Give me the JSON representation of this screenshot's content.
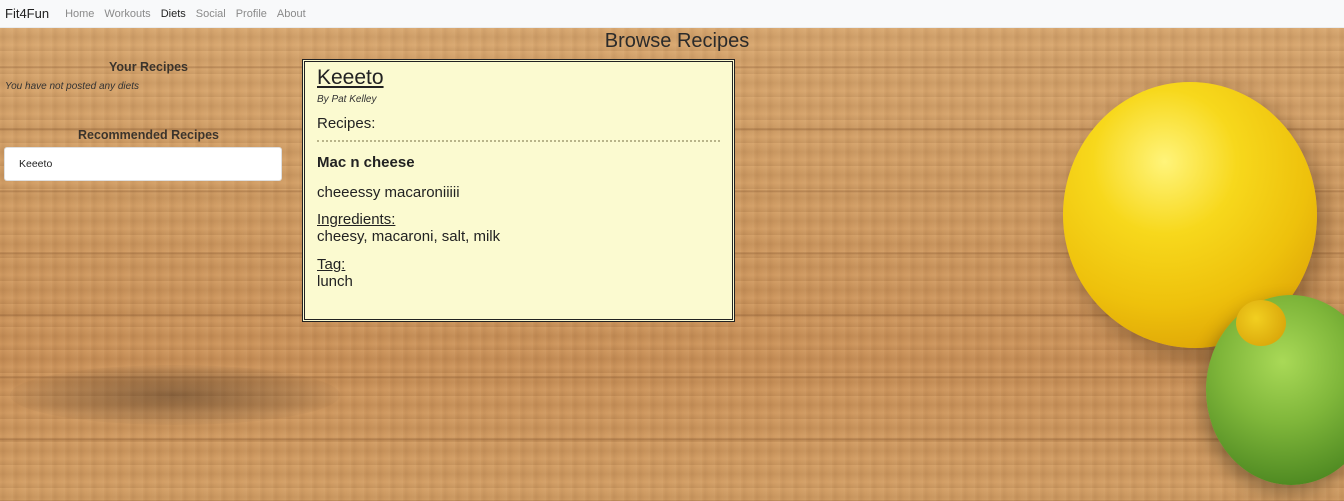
{
  "navbar": {
    "brand": "Fit4Fun",
    "links": [
      {
        "label": "Home",
        "active": false
      },
      {
        "label": "Workouts",
        "active": false
      },
      {
        "label": "Diets",
        "active": true
      },
      {
        "label": "Social",
        "active": false
      },
      {
        "label": "Profile",
        "active": false
      },
      {
        "label": "About",
        "active": false
      }
    ]
  },
  "page": {
    "title": "Browse Recipes"
  },
  "sidebar": {
    "your_recipes_title": "Your Recipes",
    "your_recipes_empty": "You have not posted any diets",
    "recommended_title": "Recommended Recipes",
    "recommended_items": [
      "Keeeto"
    ]
  },
  "diet_card": {
    "title": "Keeeto",
    "author": "By Pat Kelley",
    "recipes_heading": "Recipes:",
    "recipe": {
      "name": "Mac n cheese",
      "description": "cheeessy macaroniiiii",
      "ingredients_label": "Ingredients:",
      "ingredients": "cheesy, macaroni, salt, milk",
      "tag_label": "Tag:",
      "tag": "lunch"
    }
  },
  "colors": {
    "navbar_bg": "#f8f9fa",
    "card_bg": "#fbfad0",
    "text": "#222222"
  }
}
